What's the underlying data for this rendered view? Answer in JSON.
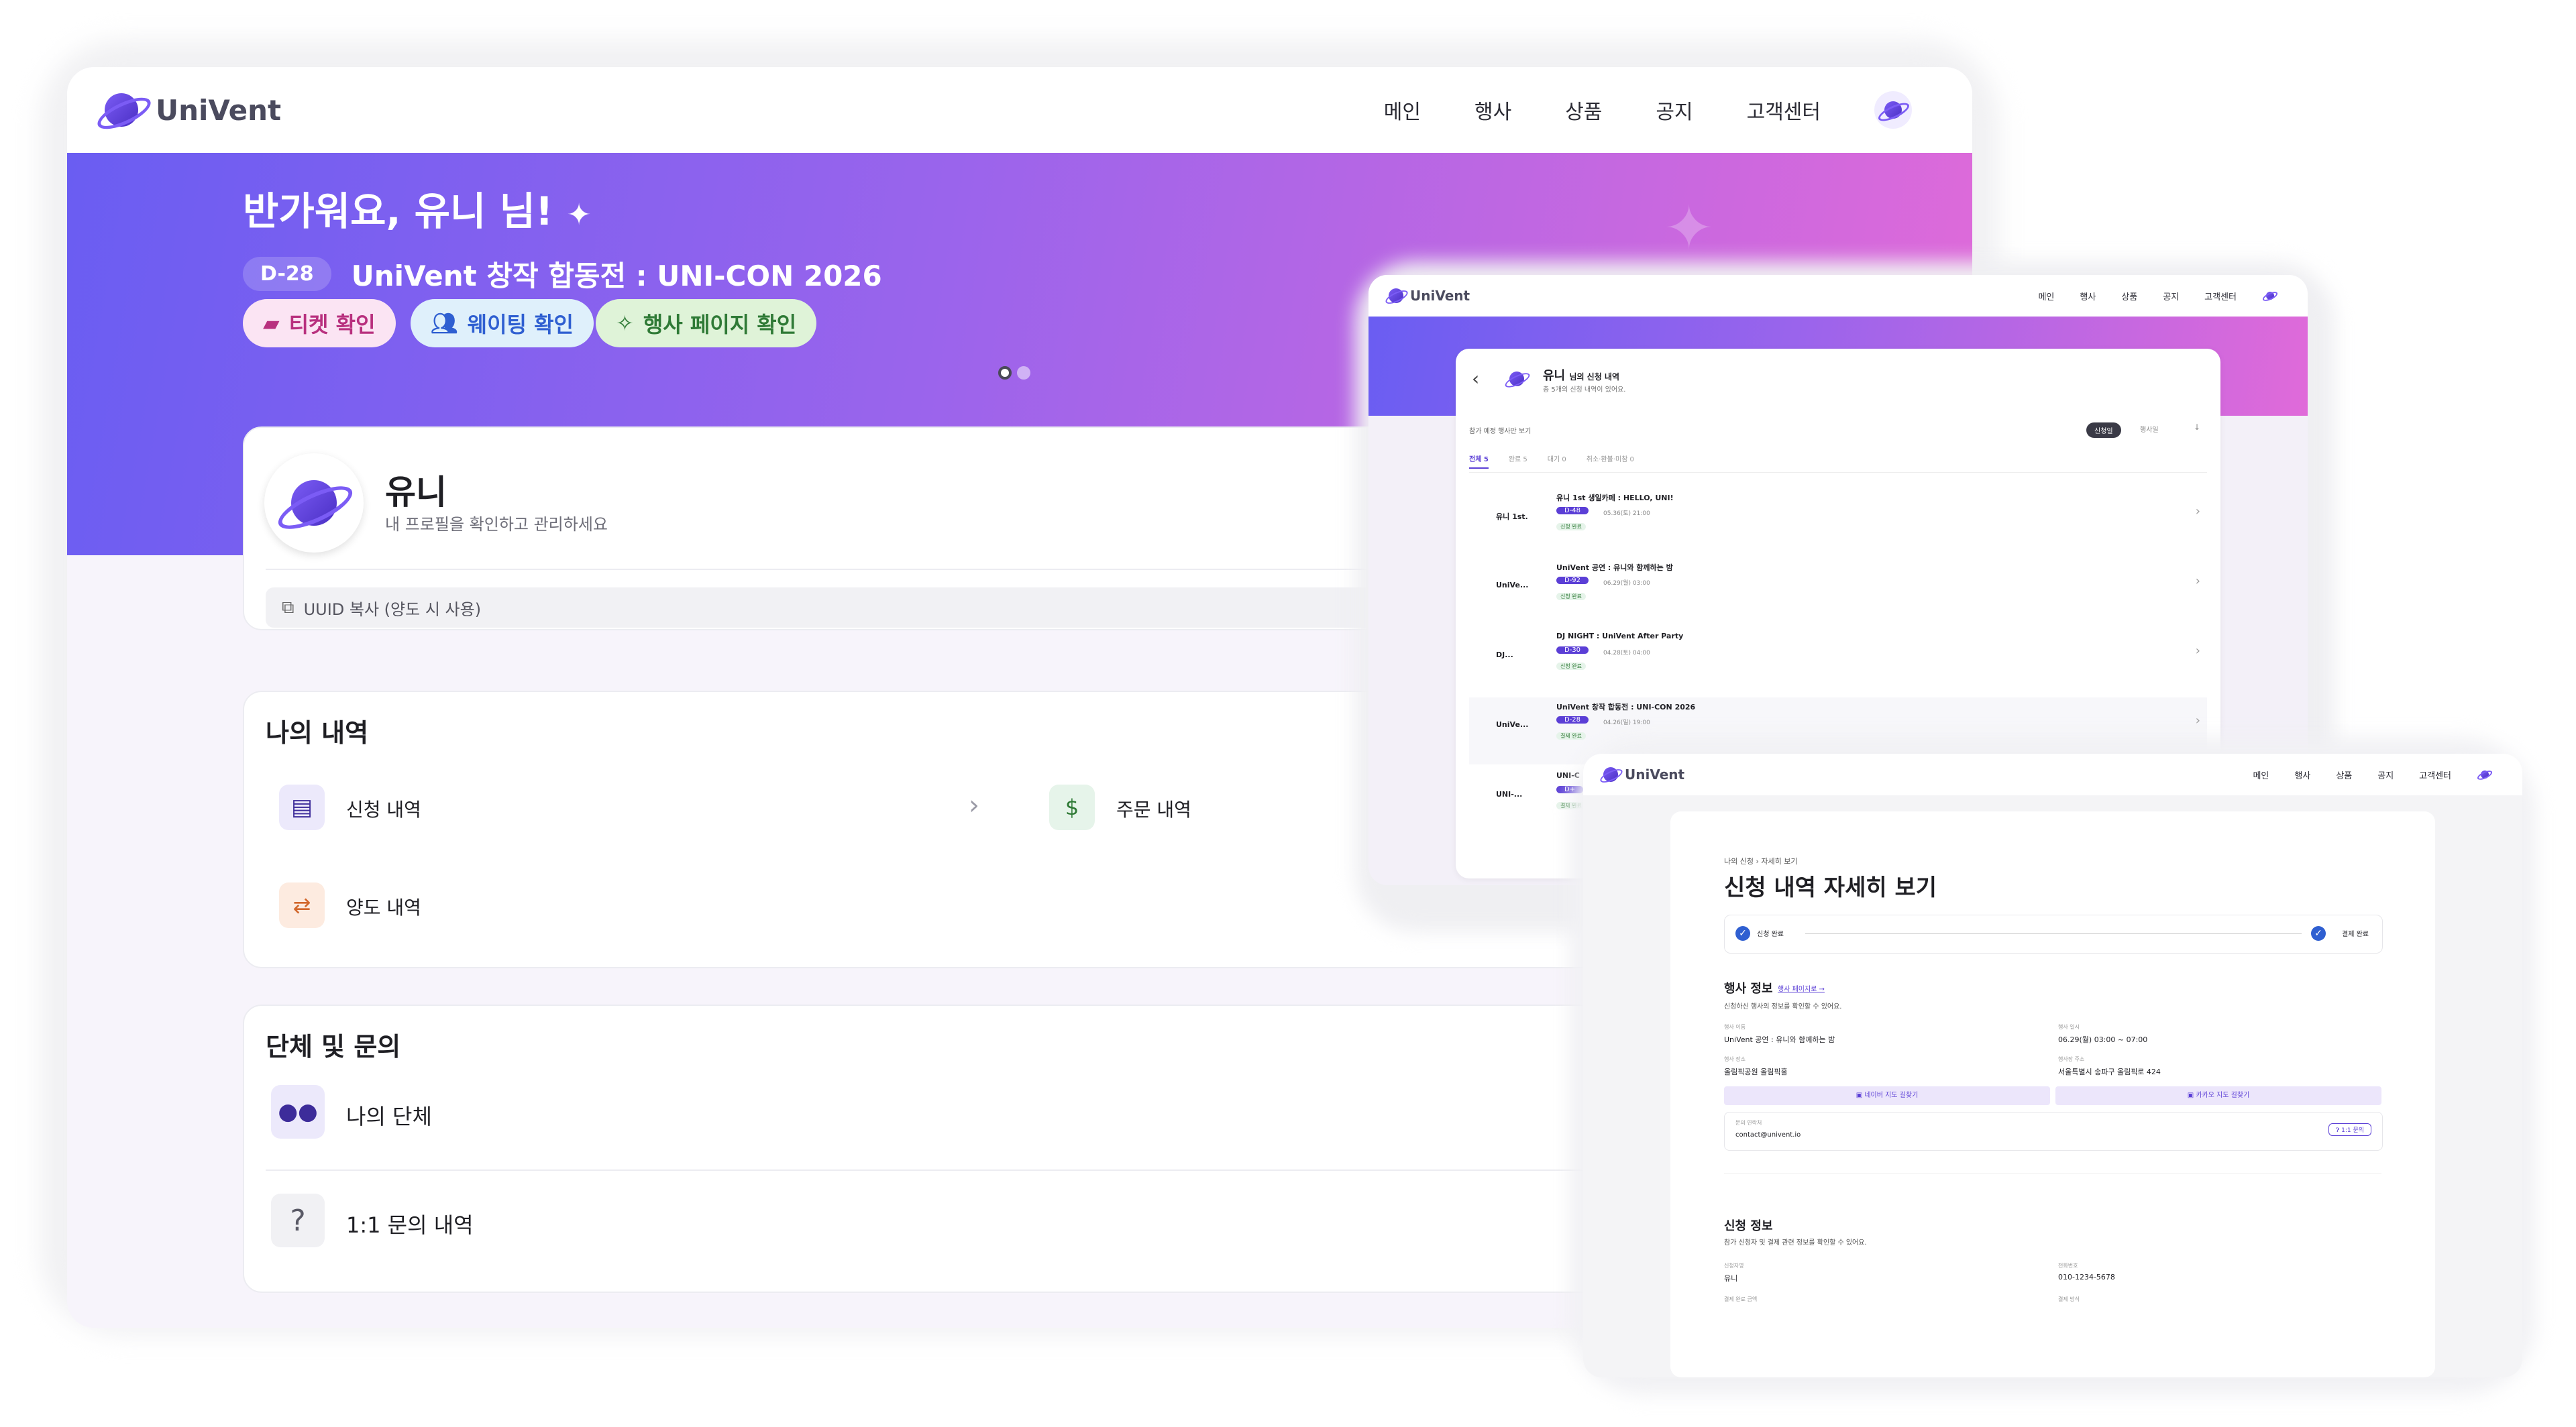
{
  "brand": "UniVent",
  "nav": {
    "items": [
      "메인",
      "행사",
      "상품",
      "공지",
      "고객센터"
    ]
  },
  "hero": {
    "greeting": "반가워요, 유니 님!",
    "dday": "D-28",
    "event_title": "UniVent 창작 합동전 : UNI-CON 2026",
    "buttons": {
      "ticket": "티켓 확인",
      "waiting": "웨이팅 확인",
      "event_page": "행사 페이지 확인"
    }
  },
  "profile": {
    "name": "유니",
    "subtitle": "내 프로필을 확인하고 관리하세요",
    "uuid_copy": "UUID 복사 (양도 시 사용)"
  },
  "history": {
    "title": "나의 내역",
    "application": "신청 내역",
    "orders": "주문 내역",
    "transfer": "양도 내역"
  },
  "groups": {
    "title": "단체 및 문의",
    "my_group": "나의 단체",
    "inquiry": "1:1 문의 내역"
  },
  "list_window": {
    "title": "유니",
    "title_suffix": "님의 신청 내역",
    "subtitle": "총 5개의 신청 내역이 있어요.",
    "filter_link": "참가 예정 행사만 보기",
    "sort_apply": "신청일",
    "sort_event": "행사일",
    "tabs": [
      "전체 5",
      "완료 5",
      "대기 0",
      "취소·환불·미참 0"
    ],
    "items": [
      {
        "thumb": "유니 1st.",
        "title": "유니 1st 생일카페 : HELLO, UNI!",
        "dday": "D-48",
        "date": "05.36(토) 21:00",
        "status": "신청 완료"
      },
      {
        "thumb": "UniVe...",
        "title": "UniVent 공연 : 유니와 함께하는 밤",
        "dday": "D-92",
        "date": "06.29(월) 03:00",
        "status": "신청 완료"
      },
      {
        "thumb": "DJ...",
        "title": "DJ NIGHT : UniVent After Party",
        "dday": "D-30",
        "date": "04.28(토) 04:00",
        "status": "신청 완료"
      },
      {
        "thumb": "UniVe...",
        "title": "UniVent 창작 합동전 : UNI-CON 2026",
        "dday": "D-28",
        "date": "04.26(일) 19:00",
        "status": "결제 완료"
      },
      {
        "thumb": "UNI-...",
        "title": "UNI-C",
        "dday": "D+",
        "date": "",
        "status": "결제 완료"
      }
    ]
  },
  "detail_window": {
    "breadcrumb": [
      "나의 신청",
      "자세히 보기"
    ],
    "title": "신청 내역 자세히 보기",
    "steps": [
      "신청 완료",
      "결제 완료"
    ],
    "event_section": {
      "title": "행사 정보",
      "link": "행사 페이지로 →",
      "desc": "신청하신 행사의 정보를 확인할 수 있어요."
    },
    "fields": {
      "event_name_label": "행사 이름",
      "event_name": "UniVent 공연 : 유니와 함께하는 밤",
      "event_date_label": "행사 일시",
      "event_date": "06.29(월) 03:00 ~ 07:00",
      "venue_label": "행사 장소",
      "venue": "올림픽공원 올림픽홀",
      "address_label": "행사장 주소",
      "address": "서울특별시 송파구 올림픽로 424"
    },
    "map_naver": "네이버 지도 길찾기",
    "map_kakao": "카카오 지도 길찾기",
    "contact_label": "문의 연락처",
    "contact": "contact@univent.io",
    "inquiry_btn": "1:1 문의",
    "apply_section": {
      "title": "신청 정보",
      "desc": "참가 신청자 및 결제 관련 정보를 확인할 수 있어요."
    },
    "applicant_label": "신청자명",
    "applicant": "유니",
    "phone_label": "전화번호",
    "phone": "010-1234-5678",
    "payment_amount_label": "결제 완료 금액",
    "payment_method_label": "결제 방식"
  },
  "colors": {
    "accent": "#7c5cf5",
    "gradient_start": "#6d5ff1",
    "gradient_end": "#e86ad8",
    "page_bg": "#f5f3f9"
  }
}
